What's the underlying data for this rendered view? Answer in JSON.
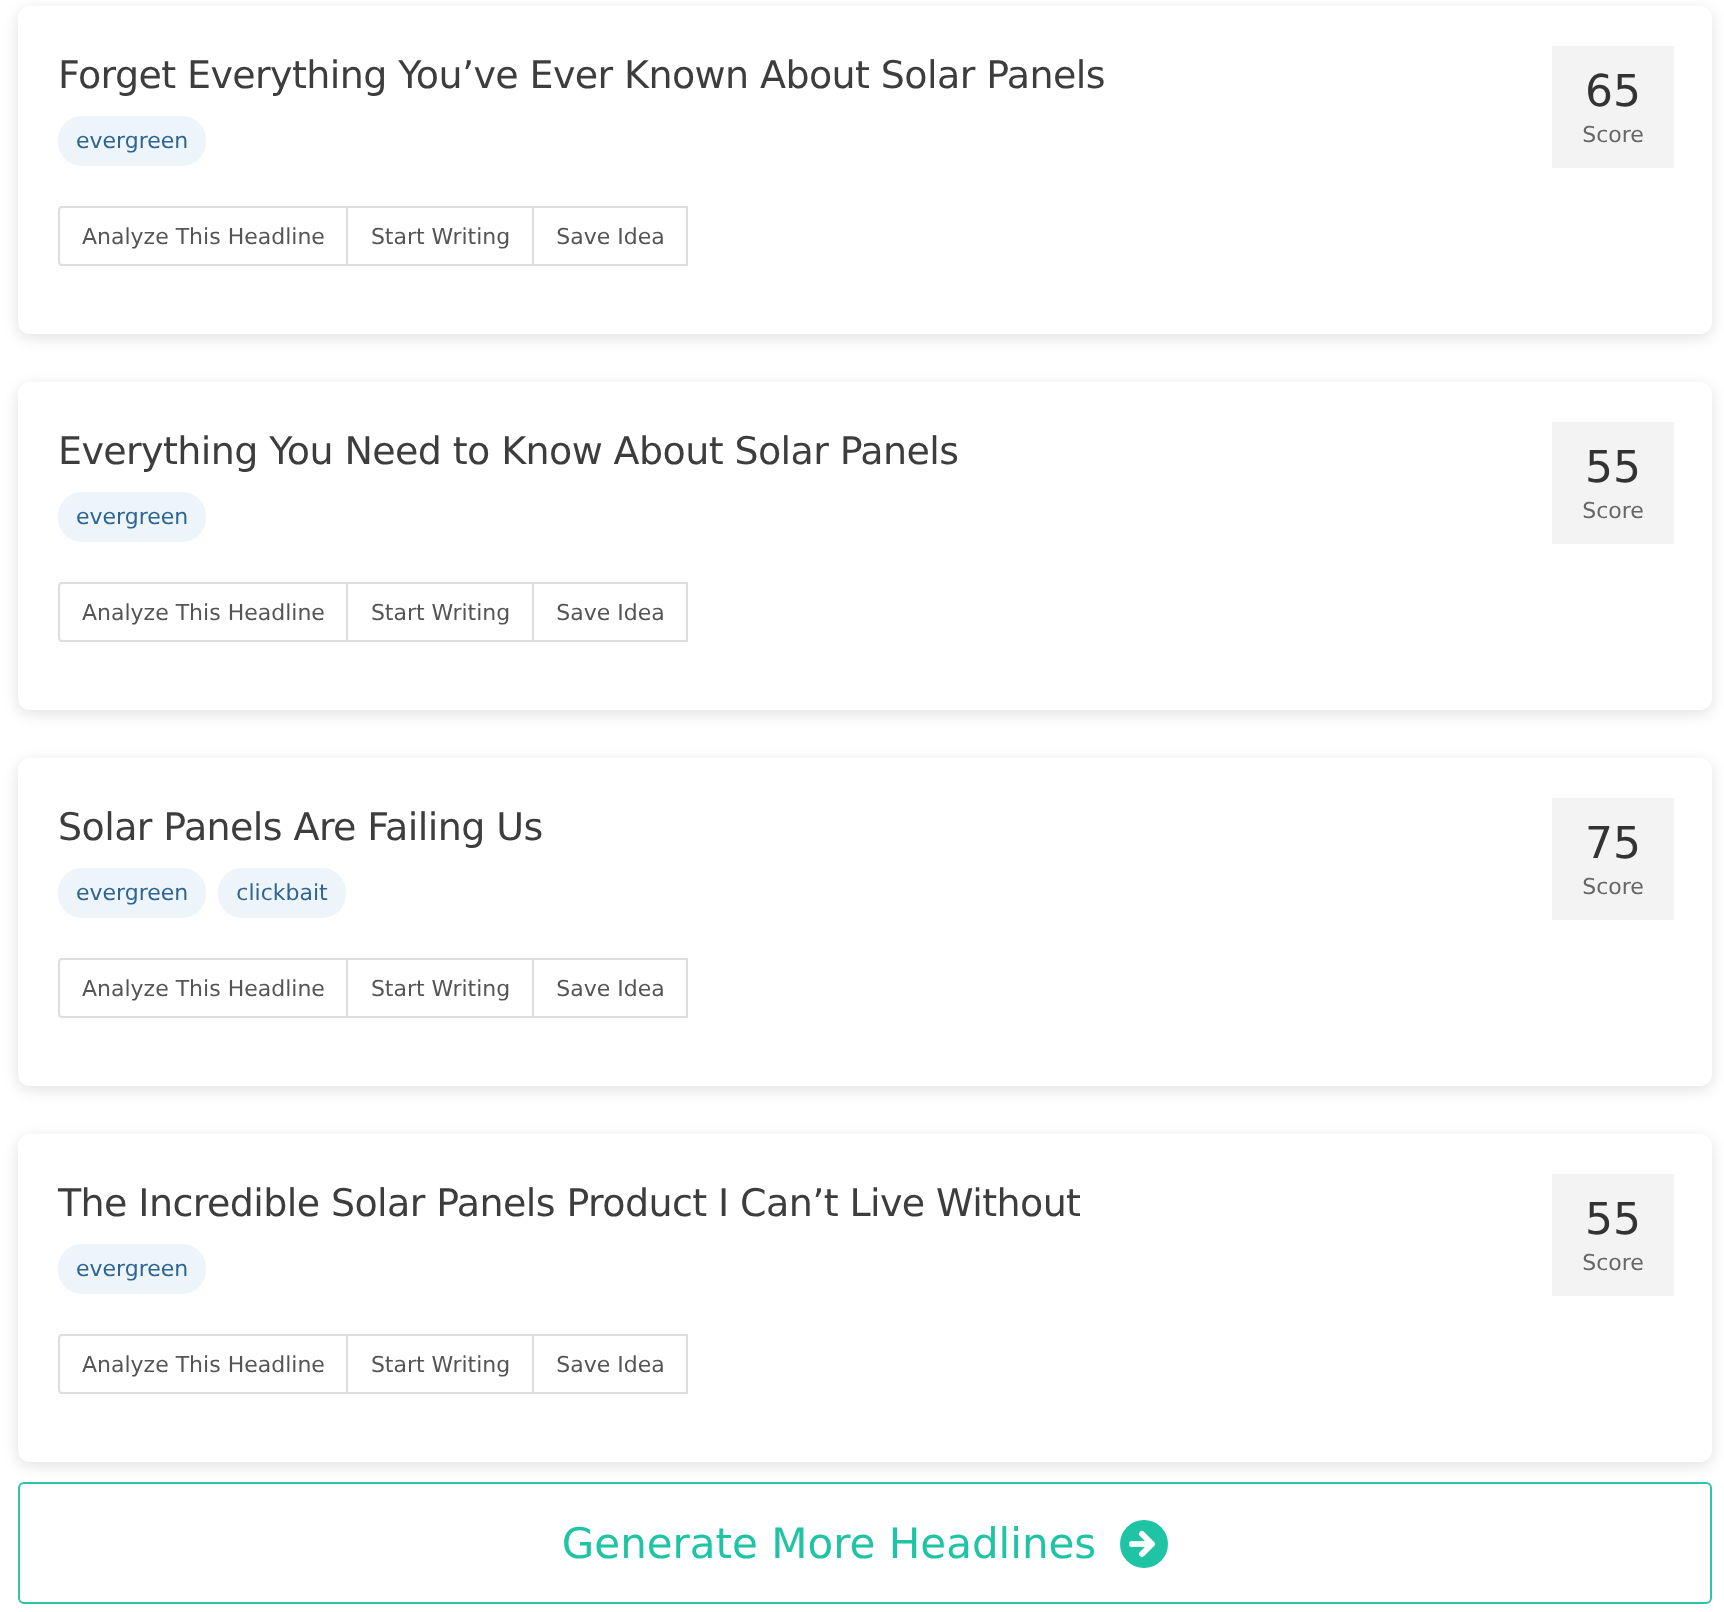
{
  "headlines": [
    {
      "title": "Forget Everything You’ve Ever Known About Solar Panels",
      "tags": [
        "evergreen"
      ],
      "score": "65",
      "score_label": "Score",
      "actions": [
        "Analyze This Headline",
        "Start Writing",
        "Save Idea"
      ]
    },
    {
      "title": "Everything You Need to Know About Solar Panels",
      "tags": [
        "evergreen"
      ],
      "score": "55",
      "score_label": "Score",
      "actions": [
        "Analyze This Headline",
        "Start Writing",
        "Save Idea"
      ]
    },
    {
      "title": "Solar Panels Are Failing Us",
      "tags": [
        "evergreen",
        "clickbait"
      ],
      "score": "75",
      "score_label": "Score",
      "actions": [
        "Analyze This Headline",
        "Start Writing",
        "Save Idea"
      ]
    },
    {
      "title": "The Incredible Solar Panels Product I Can’t Live Without",
      "tags": [
        "evergreen"
      ],
      "score": "55",
      "score_label": "Score",
      "actions": [
        "Analyze This Headline",
        "Start Writing",
        "Save Idea"
      ]
    }
  ],
  "generate_button": "Generate More Headlines"
}
